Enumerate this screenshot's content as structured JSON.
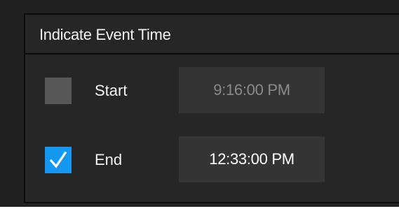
{
  "panel": {
    "title": "Indicate Event Time"
  },
  "start": {
    "label": "Start",
    "checked": false,
    "time": "9:16:00 PM"
  },
  "end": {
    "label": "End",
    "checked": true,
    "time": "12:33:00 PM"
  },
  "colors": {
    "accent": "#1397f1",
    "background": "#262626",
    "field": "#343434",
    "checkbox_off": "#575757"
  },
  "icons": {
    "checkmark": "check-icon"
  }
}
